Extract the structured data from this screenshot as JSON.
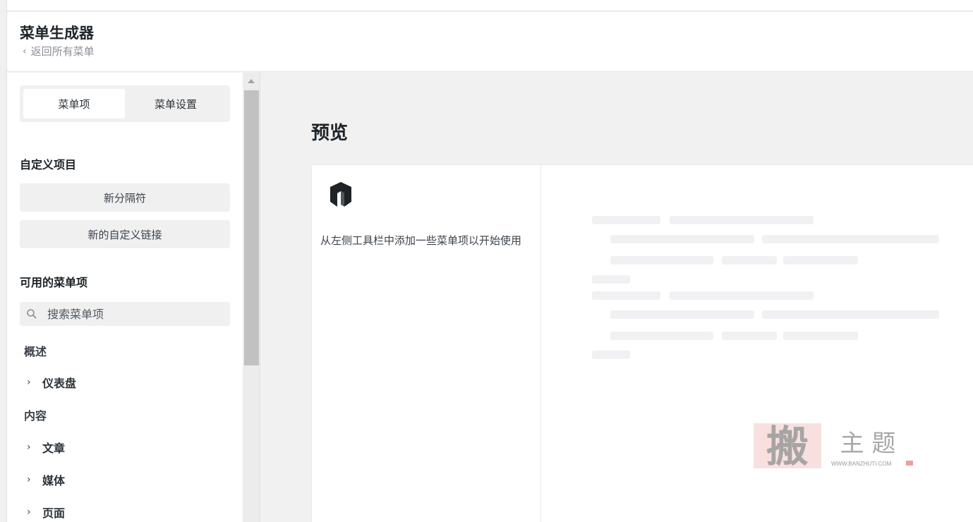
{
  "header": {
    "title": "菜单生成器",
    "back_label": "返回所有菜单"
  },
  "sidebar": {
    "tabs": [
      {
        "label": "菜单项",
        "active": true
      },
      {
        "label": "菜单设置",
        "active": false
      }
    ],
    "custom_section": {
      "title": "自定义项目",
      "buttons": [
        "新分隔符",
        "新的自定义链接"
      ]
    },
    "available_section": {
      "title": "可用的菜单项",
      "search_placeholder": "搜索菜单项"
    },
    "groups": [
      {
        "label": "概述",
        "items": [
          "仪表盘"
        ]
      },
      {
        "label": "内容",
        "items": [
          "文章",
          "媒体",
          "页面"
        ]
      }
    ]
  },
  "preview": {
    "title": "预览",
    "empty_message": "从左侧工具栏中添加一些菜单项以开始使用"
  },
  "watermark": {
    "glyph": "搬",
    "text": "主 题",
    "url": "WWW.BANZHUTI.COM"
  },
  "colors": {
    "accent_bg": "#f0f0f1",
    "text_dark": "#1d2327",
    "skeleton": "#f1f1f3",
    "watermark_red": "#e8a0a0"
  }
}
